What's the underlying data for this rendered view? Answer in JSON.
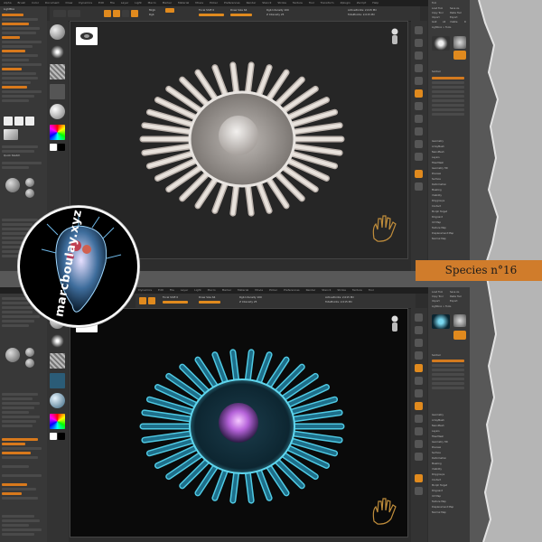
{
  "menu_items": [
    "Alpha",
    "Brush",
    "Color",
    "Document",
    "Draw",
    "Dynamics",
    "Edit",
    "File",
    "Layer",
    "Light",
    "Macro",
    "Marker",
    "Material",
    "Movie",
    "Picker",
    "Preferences",
    "Render",
    "Stencil",
    "Stroke",
    "Texture",
    "Tool",
    "Transform",
    "Zplugin",
    "Zscript",
    "Help"
  ],
  "toolbar": {
    "mrgb": "Mrgb",
    "rgb": "Rgb",
    "m": "M",
    "zadd": "Zadd",
    "zsub": "Zsub",
    "focal_shift": "Focal Shift 0",
    "draw_size": "Draw Size 64",
    "dynamic": "Dynamic",
    "rgb_intensity": "Rgb Intensity 100",
    "z_intensity": "Z Intensity 25",
    "active_points": "ActivePoints: 2,015 Mil",
    "total_points": "TotalPoints: 2,015 Mil"
  },
  "left_panel": {
    "lightbox": "LightBox",
    "quick_sketch": "Quick Sketch",
    "edit": "Edit",
    "draw": "Draw",
    "move": "Move",
    "scale": "Scale",
    "rotate": "Rotate"
  },
  "right_panel": {
    "title": "Tool",
    "load_tool": "Load Tool",
    "save_as": "Save As",
    "copy_tool": "Copy Tool",
    "paste_tool": "Paste Tool",
    "import": "Import",
    "export": "Export",
    "goz": "GoZ",
    "all": "All",
    "visible": "Visible",
    "r": "R",
    "lightbox_tools": "Lightbox > Tools",
    "subtool": "Subtool",
    "geometry": "Geometry",
    "array_mesh": "ArrayMesh",
    "nanomesh": "NanoMesh",
    "layers": "Layers",
    "fibermesh": "FiberMesh",
    "geometry_hd": "Geometry HD",
    "preview": "Preview",
    "surface": "Surface",
    "deformation": "Deformation",
    "masking": "Masking",
    "visibility": "Visibility",
    "polygroups": "Polygroups",
    "contact": "Contact",
    "morph_target": "Morph Target",
    "polypaint": "Polypaint",
    "uv_map": "UV Map",
    "texture_map": "Texture Map",
    "displacement_map": "Displacement Map",
    "normal_map": "Normal Map"
  },
  "overlay": {
    "species_label": "Species n°16",
    "watermark": "marcboulay.xyz"
  },
  "colors": {
    "accent": "#e08a1e",
    "background": "#585858",
    "panel": "#383838",
    "viewport": "#262626",
    "render_glow": "#3fc6e6"
  }
}
